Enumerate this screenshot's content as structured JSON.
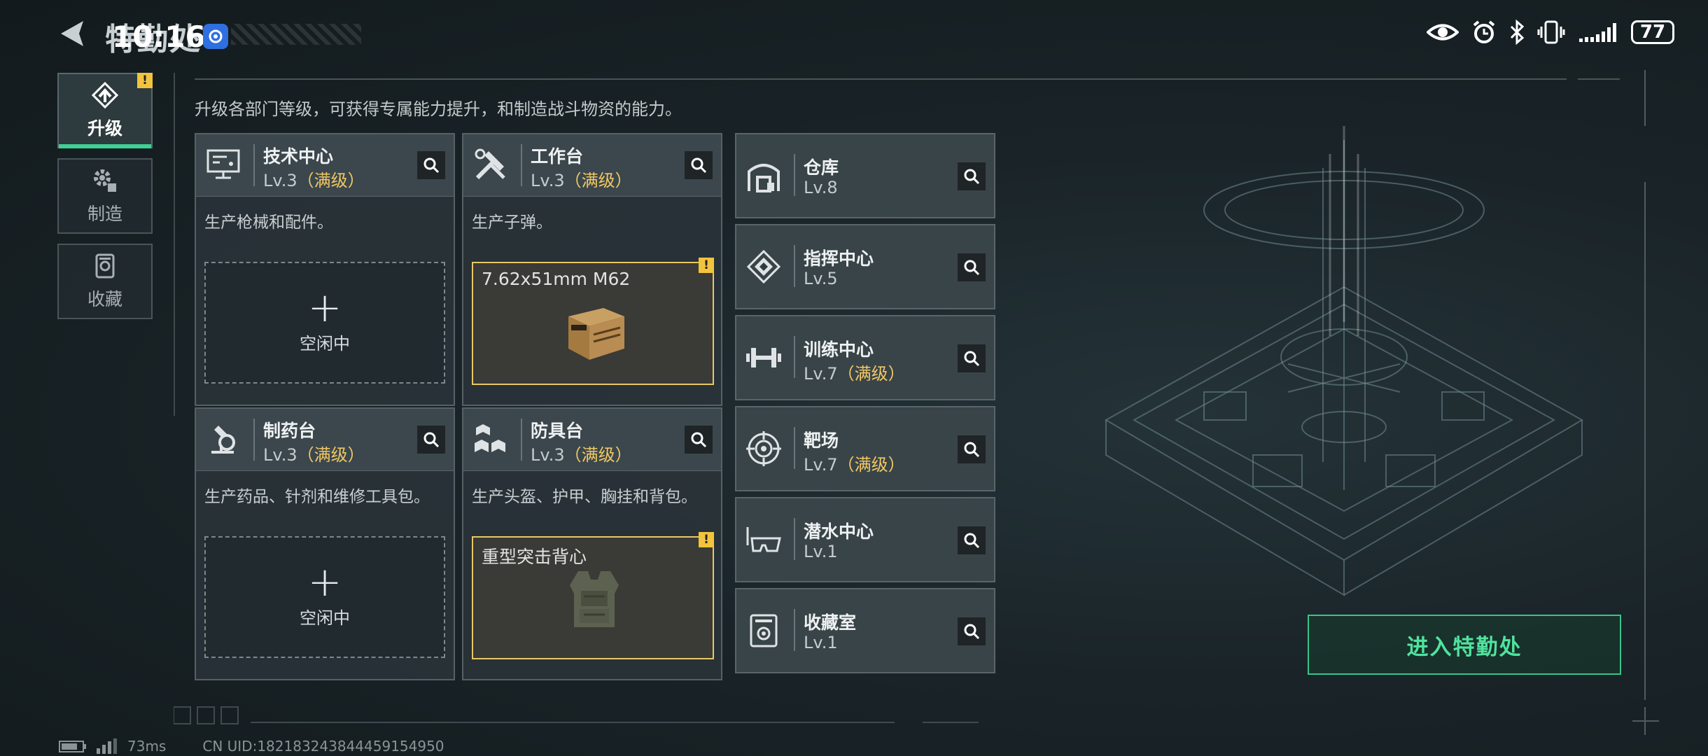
{
  "header": {
    "back_icon": "back-arrow-icon",
    "title": "特勤处",
    "clock": "10:16",
    "badge_icon": "app-badge-icon"
  },
  "status": {
    "icons": [
      "eye-icon",
      "alarm-icon",
      "bluetooth-icon",
      "vibrate-icon",
      "signal-icon"
    ],
    "battery": "77"
  },
  "sidebar": {
    "items": [
      {
        "label": "升级",
        "icon": "upgrade-icon",
        "active": true,
        "warning": "!"
      },
      {
        "label": "制造",
        "icon": "craft-gear-icon",
        "active": false
      },
      {
        "label": "收藏",
        "icon": "collection-icon",
        "active": false
      }
    ]
  },
  "subtitle": "升级各部门等级，可获得专属能力提升，和制造战斗物资的能力。",
  "departments": [
    {
      "name": "技术中心",
      "level": "Lv.3",
      "max": "（满级）",
      "icon": "computer-icon",
      "desc": "生产枪械和配件。",
      "slot": {
        "state": "idle",
        "plus": "+",
        "label": "空闲中"
      }
    },
    {
      "name": "工作台",
      "level": "Lv.3",
      "max": "（满级）",
      "icon": "tools-icon",
      "desc": "生产子弹。",
      "slot": {
        "state": "active",
        "item": "7.62x51mm M62",
        "warning": "!"
      }
    },
    {
      "name": "制药台",
      "level": "Lv.3",
      "max": "（满级）",
      "icon": "microscope-icon",
      "desc": "生产药品、针剂和维修工具包。",
      "slot": {
        "state": "idle",
        "plus": "+",
        "label": "空闲中"
      }
    },
    {
      "name": "防具台",
      "level": "Lv.3",
      "max": "（满级）",
      "icon": "boxes-icon",
      "desc": "生产头盔、护甲、胸挂和背包。",
      "slot": {
        "state": "active",
        "item": "重型突击背心",
        "warning": "!"
      }
    }
  ],
  "facilities": [
    {
      "name": "仓库",
      "level": "Lv.8",
      "max": "",
      "icon": "warehouse-icon"
    },
    {
      "name": "指挥中心",
      "level": "Lv.5",
      "max": "",
      "icon": "command-icon"
    },
    {
      "name": "训练中心",
      "level": "Lv.7",
      "max": "（满级）",
      "icon": "dumbbell-icon"
    },
    {
      "name": "靶场",
      "level": "Lv.7",
      "max": "（满级）",
      "icon": "target-icon"
    },
    {
      "name": "潜水中心",
      "level": "Lv.1",
      "max": "",
      "icon": "diving-mask-icon"
    },
    {
      "name": "收藏室",
      "level": "Lv.1",
      "max": "",
      "icon": "collection-room-icon"
    }
  ],
  "enter_button": "进入特勤处",
  "footer": {
    "ping": "73ms",
    "uid": "CN UID:1821832438444591549​50"
  },
  "colors": {
    "accent_green": "#3fd096",
    "max_level_gold": "#f0c764",
    "warning_yellow": "#f2c33d"
  }
}
